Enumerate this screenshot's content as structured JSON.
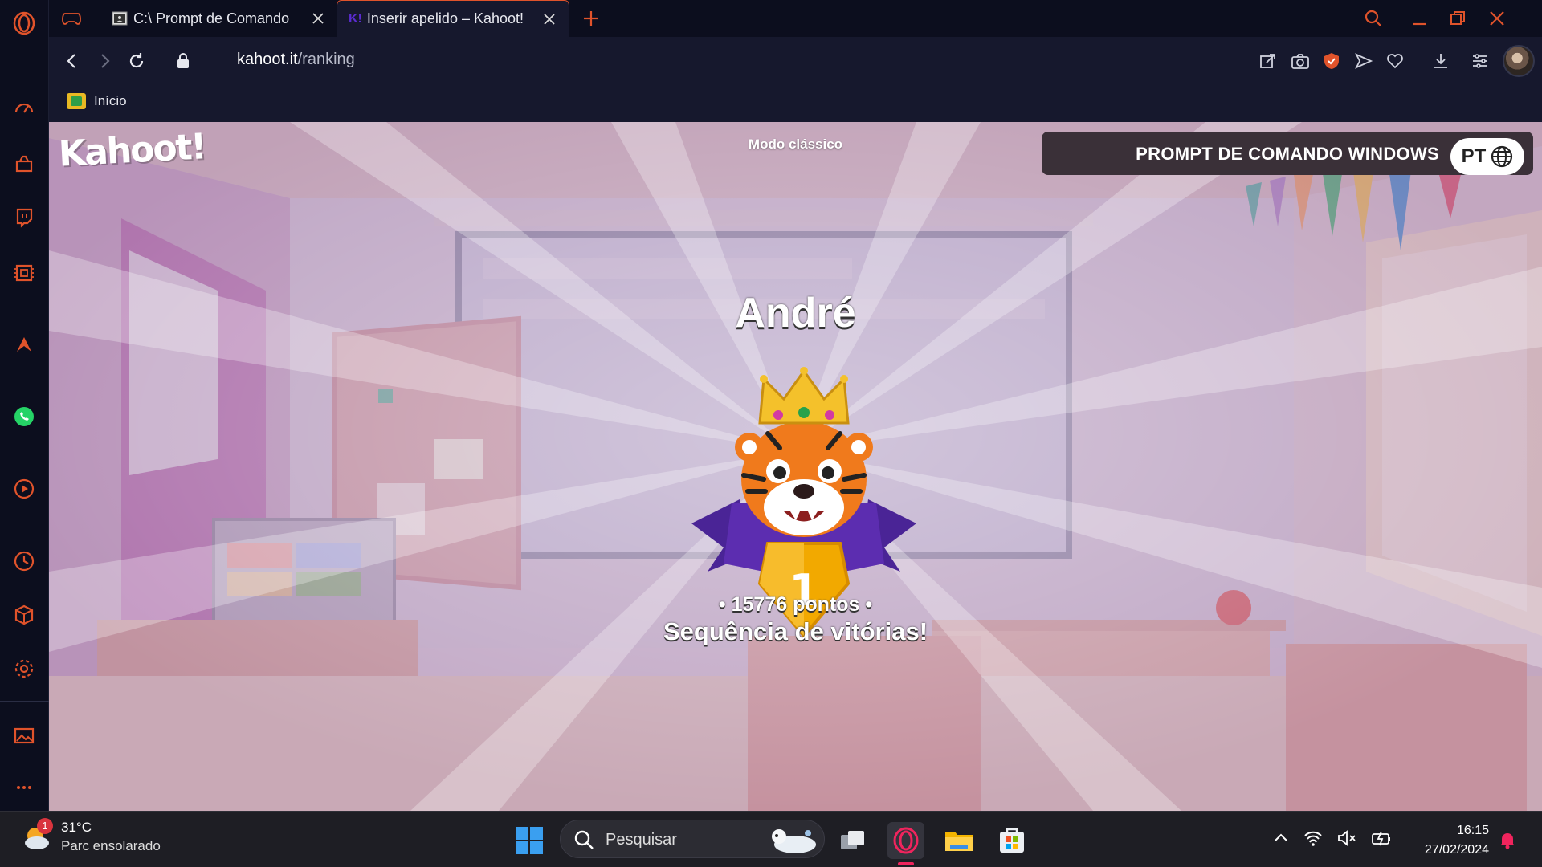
{
  "browser": {
    "tabs": [
      {
        "label": "C:\\ Prompt de Comando",
        "active": false
      },
      {
        "label": "Inserir apelido – Kahoot!",
        "active": true
      }
    ],
    "url_host": "kahoot.it",
    "url_path": "/ranking",
    "bookmarks": [
      {
        "label": "Início"
      }
    ]
  },
  "kahoot": {
    "logo": "Kahoot!",
    "mode": "Modo clássico",
    "game_title": "PROMPT DE COMANDO WINDOWS",
    "language": "PT",
    "nickname": "André",
    "rank": "1",
    "points": "• 15776 pontos •",
    "message": "Sequência de vitórias!",
    "colors": {
      "medal_gold": "#f2a900",
      "ribbon_purple": "#5c2db0",
      "overlay": "#b79ac0"
    }
  },
  "taskbar": {
    "weather_temp": "31°C",
    "weather_desc": "Parc ensolarado",
    "weather_badge": "1",
    "search_placeholder": "Pesquisar",
    "time": "16:15",
    "date": "27/02/2024"
  }
}
